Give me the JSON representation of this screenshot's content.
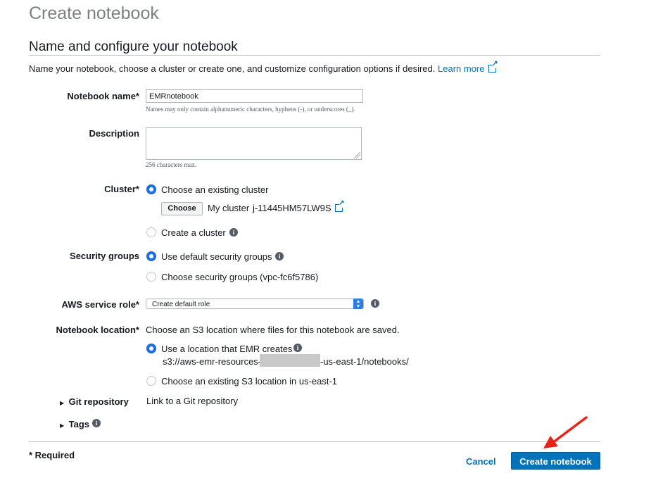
{
  "page": {
    "title": "Create notebook"
  },
  "section": {
    "title": "Name and configure your notebook",
    "intro": "Name your notebook, choose a cluster or create one, and customize configuration options if desired.",
    "learn_more": "Learn more"
  },
  "form": {
    "notebook_name": {
      "label": "Notebook name*",
      "value": "EMRnotebook",
      "hint": "Names may only contain alphanumeric characters, hyphens (-), or underscores (_)."
    },
    "description": {
      "label": "Description",
      "value": "",
      "hint": "256 characters max."
    },
    "cluster": {
      "label": "Cluster*",
      "option_existing": "Choose an existing cluster",
      "choose_button": "Choose",
      "my_cluster_label": "My cluster",
      "cluster_id": "j-11445HM57LW9S",
      "option_create": "Create a cluster",
      "selected": "existing"
    },
    "security_groups": {
      "label": "Security groups",
      "option_default": "Use default security groups",
      "option_choose": "Choose security groups (vpc-fc6f5786)",
      "selected": "default"
    },
    "service_role": {
      "label": "AWS service role*",
      "selected_value": "Create default role"
    },
    "location": {
      "label": "Notebook location*",
      "description": "Choose an S3 location where files for this notebook are saved.",
      "option_emr": "Use a location that EMR creates",
      "path_prefix": "s3://aws-emr-resources-",
      "path_suffix": "-us-east-1/notebooks/",
      "option_existing": "Choose an existing S3 location in us-east-1",
      "selected": "emr"
    },
    "git": {
      "label": "Git repository",
      "link_text": "Link to a Git repository"
    },
    "tags": {
      "label": "Tags"
    }
  },
  "footer": {
    "required_note": "* Required",
    "cancel_label": "Cancel",
    "create_label": "Create notebook"
  },
  "colors": {
    "accent": "#0073bb",
    "radio_selected": "#1a73e8",
    "annotation_arrow": "#e8231c"
  },
  "icons": [
    "external-link-icon",
    "info-icon",
    "caret-right-icon",
    "select-arrow-icon",
    "resize-grip-icon"
  ]
}
